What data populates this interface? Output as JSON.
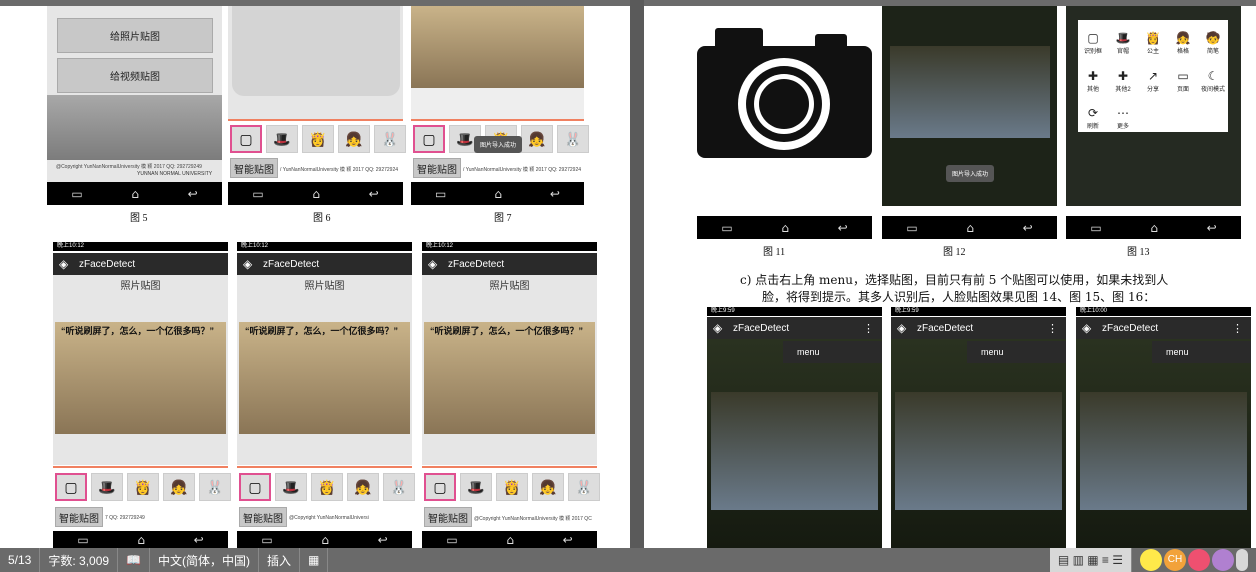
{
  "figs_top_left": [
    "图 5",
    "图 6",
    "图 7"
  ],
  "figs_top_right": [
    "图 11",
    "图 12",
    "图 13"
  ],
  "fig5": {
    "btn1": "给照片贴图",
    "btn2": "给视频贴图",
    "copyright": "@Copyright YunNanNormalUniversity 模 颖 2017 QQ: 292729249",
    "univ": "YUNNAN NORMAL UNIVERSITY"
  },
  "smart_btn": "智能贴图",
  "copy_short": "/ YunNanNormalUniversity 模 颖 2017 QQ: 29272924",
  "copy_a": "7 QQ: 292729249",
  "copy_b": "@Copyright YunNanNormalUniversi",
  "copy_c": "@Copyright YunNanNormalUniversity 模 颖 2017 QC",
  "toast": "图片导入成功",
  "status_time": "晚上10:12",
  "app_title": "zFaceDetect",
  "photo_title": "照片贴图",
  "quote": "“听说刷屏了，怎么，一个亿很多吗？”",
  "grid13": [
    "识别框",
    "官帽",
    "公主",
    "格格",
    "简笔",
    "其他",
    "其他2",
    "分享",
    "页面",
    "夜间模式",
    "刷新",
    "更多"
  ],
  "para_c": "c)  点击右上角 menu，选择贴图，目前只有前 5 个贴图可以使用，如果未找到人",
  "para_c2": "脸，将得到提示。其多人识别后，人脸贴图效果见图 14、图 15、图 16：",
  "status_times": [
    "晚上9:59",
    "晚上9:59",
    "晚上10:00"
  ],
  "menu": "menu",
  "statusbar": {
    "page": "5/13",
    "words": "字数: 3,009",
    "lang": "中文(简体，中国)",
    "mode": "插入"
  }
}
